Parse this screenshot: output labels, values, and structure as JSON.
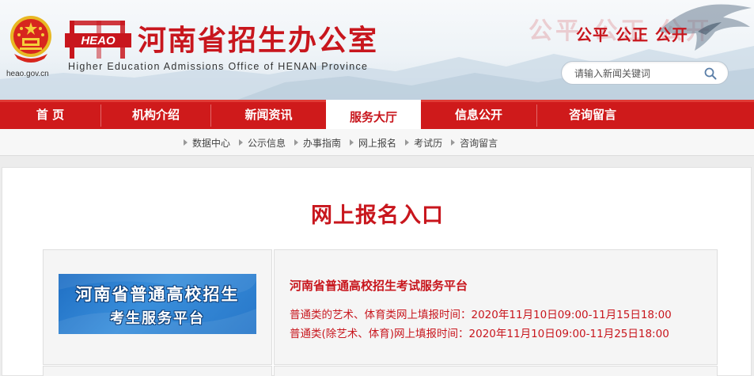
{
  "header": {
    "domain": "heao.gov.cn",
    "logo_text": "HEAO",
    "title": "河南省招生办公室",
    "subtitle": "Higher Education Admissions Office of HENAN Province",
    "slogan": "公平 公正 公开",
    "slogan_watermark": "公平 公正 公开",
    "search": {
      "placeholder": "请输入新闻关键词"
    }
  },
  "nav": {
    "items": [
      {
        "label": "首 页"
      },
      {
        "label": "机构介绍"
      },
      {
        "label": "新闻资讯"
      },
      {
        "label": "服务大厅"
      },
      {
        "label": "信息公开"
      },
      {
        "label": "咨询留言"
      }
    ],
    "active_label": "服务大厅"
  },
  "subnav": {
    "items": [
      {
        "label": "数据中心"
      },
      {
        "label": "公示信息"
      },
      {
        "label": "办事指南"
      },
      {
        "label": "网上报名"
      },
      {
        "label": "考试历"
      },
      {
        "label": "咨询留言"
      }
    ]
  },
  "main": {
    "title": "网上报名入口",
    "banner": {
      "line1": "河南省普通高校招生",
      "line2": "考生服务平台"
    },
    "platform": {
      "title": "河南省普通高校招生考试服务平台",
      "line1": "普通类的艺术、体育类网上填报时间：2020年11月10日09:00-11月15日18:00",
      "line2": "普通类(除艺术、体育)网上填报时间：2020年11月10日09:00-11月25日18:00"
    }
  },
  "colors": {
    "brand_red": "#c8161d",
    "nav_red": "#cf1a1b",
    "banner_blue": "#2a7bd0"
  },
  "icons": [
    "national-emblem-icon",
    "heao-logo-icon",
    "eagle-icon",
    "search-icon",
    "arrow-right-icon"
  ]
}
